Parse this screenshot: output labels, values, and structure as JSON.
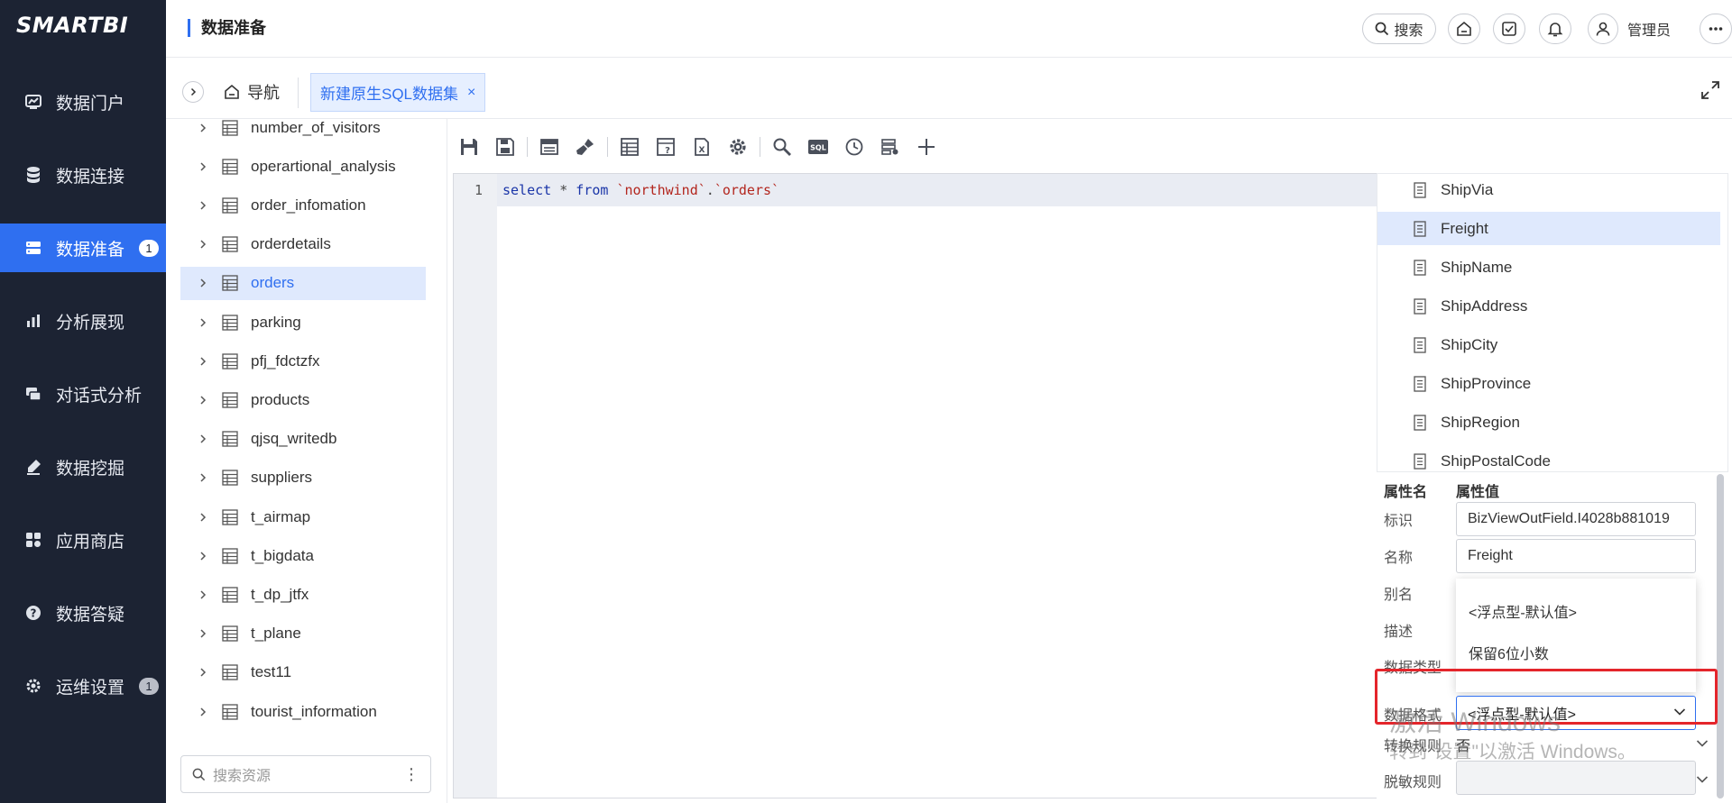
{
  "app": {
    "logo": "SMARTBI"
  },
  "sidebar": {
    "items": [
      {
        "label": "数据门户",
        "icon": "portal-chart-icon"
      },
      {
        "label": "数据连接",
        "icon": "database-icon"
      },
      {
        "label": "数据准备",
        "icon": "data-prep-icon",
        "badge": "1",
        "active": true
      },
      {
        "label": "分析展现",
        "icon": "bar-chart-icon"
      },
      {
        "label": "对话式分析",
        "icon": "chat-icon"
      },
      {
        "label": "数据挖掘",
        "icon": "pen-icon"
      },
      {
        "label": "应用商店",
        "icon": "grid-icon"
      },
      {
        "label": "数据答疑",
        "icon": "question-icon"
      },
      {
        "label": "运维设置",
        "icon": "gear-icon",
        "badge": "1"
      }
    ]
  },
  "header": {
    "title": "数据准备",
    "search_label": "搜索",
    "user_label": "管理员"
  },
  "tabs": {
    "nav_label": "导航",
    "active_label": "新建原生SQL数据集",
    "close": "×"
  },
  "tree": {
    "items": [
      {
        "label": "number_of_visitors"
      },
      {
        "label": "operartional_analysis"
      },
      {
        "label": "order_infomation"
      },
      {
        "label": "orderdetails"
      },
      {
        "label": "orders",
        "selected": true
      },
      {
        "label": "parking"
      },
      {
        "label": "pfj_fdctzfx"
      },
      {
        "label": "products"
      },
      {
        "label": "qjsq_writedb"
      },
      {
        "label": "suppliers"
      },
      {
        "label": "t_airmap"
      },
      {
        "label": "t_bigdata"
      },
      {
        "label": "t_dp_jtfx"
      },
      {
        "label": "t_plane"
      },
      {
        "label": "test11"
      },
      {
        "label": "tourist_information"
      }
    ],
    "search_placeholder": "搜索资源",
    "more": "⋮"
  },
  "editor": {
    "line_number": "1",
    "kw_select": "select",
    "star": "*",
    "kw_from": "from",
    "db": "`northwind`",
    "dot": ".",
    "table": "`orders`"
  },
  "fields": {
    "items": [
      {
        "label": "ShipVia"
      },
      {
        "label": "Freight",
        "selected": true
      },
      {
        "label": "ShipName"
      },
      {
        "label": "ShipAddress"
      },
      {
        "label": "ShipCity"
      },
      {
        "label": "ShipProvince"
      },
      {
        "label": "ShipRegion"
      },
      {
        "label": "ShipPostalCode"
      }
    ]
  },
  "props": {
    "col_name": "属性名",
    "col_value": "属性值",
    "id_label": "标识",
    "id_value": "BizViewOutField.I4028b881019",
    "name_label": "名称",
    "name_value": "Freight",
    "alias_label": "别名",
    "desc_label": "描述",
    "type_label": "数据类型",
    "format_label": "数据格式",
    "format_value": "<浮点型-默认值>",
    "format_options": [
      "<浮点型-默认值>",
      "保留6位小数"
    ],
    "convert_label": "转换规则",
    "convert_value": "否",
    "mask_label": "脱敏规则"
  },
  "watermark": {
    "line1": "激活 Windows",
    "line2": "转到\"设置\"以激活 Windows。"
  },
  "colors": {
    "accent": "#2f6ff0",
    "sidebar": "#1c2333",
    "highlight": "#e4252b"
  }
}
